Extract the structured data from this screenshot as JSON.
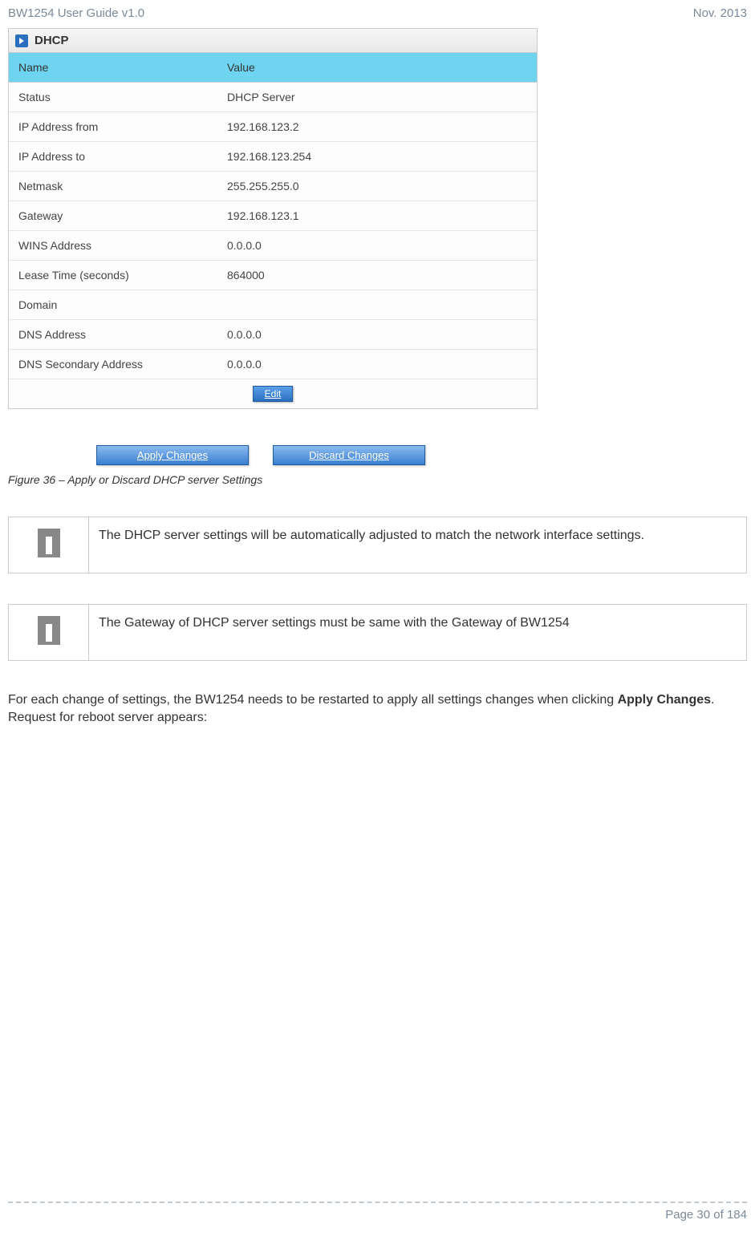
{
  "header": {
    "left": "BW1254 User Guide v1.0",
    "right": "Nov.  2013"
  },
  "dhcp": {
    "title": "DHCP",
    "columns": {
      "name": "Name",
      "value": "Value"
    },
    "rows": [
      {
        "name": "Status",
        "value": "DHCP Server"
      },
      {
        "name": "IP Address from",
        "value": "192.168.123.2"
      },
      {
        "name": "IP Address to",
        "value": "192.168.123.254"
      },
      {
        "name": "Netmask",
        "value": "255.255.255.0"
      },
      {
        "name": "Gateway",
        "value": "192.168.123.1"
      },
      {
        "name": "WINS Address",
        "value": "0.0.0.0"
      },
      {
        "name": "Lease Time (seconds)",
        "value": "864000"
      },
      {
        "name": "Domain",
        "value": ""
      },
      {
        "name": "DNS Address",
        "value": "0.0.0.0"
      },
      {
        "name": "DNS Secondary Address",
        "value": "0.0.0.0"
      }
    ],
    "edit_label": "Edit"
  },
  "buttons": {
    "apply": "Apply Changes",
    "discard": "Discard Changes"
  },
  "figure_caption": "Figure 36 – Apply or Discard DHCP server Settings",
  "info_box_1": "The DHCP server settings will be automatically adjusted to match the network interface settings.",
  "info_box_2": "The Gateway of DHCP server settings must be same with the Gateway of BW1254",
  "body_text_1": "For each change of settings, the BW1254 needs to be restarted to apply all settings changes when clicking ",
  "body_text_bold": "Apply Changes",
  "body_text_2": ". Request for reboot server appears:",
  "footer": "Page 30 of 184"
}
